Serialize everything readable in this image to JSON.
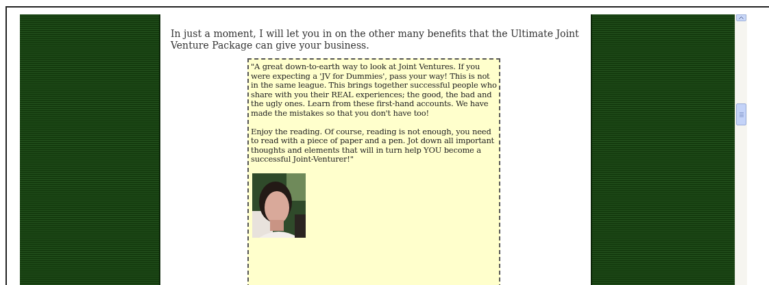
{
  "intro": "In just a moment, I will let you in on the other many benefits that the Ultimate Joint Venture Package can give your business.",
  "testimonial": {
    "paragraphs": [
      "\"A great down-to-earth way to look at Joint Ventures. If you were expecting a 'JV for Dummies', pass your way! This is not in the same league. This brings together successful people who share with you their REAL experiences; the good, the bad and the ugly ones. Learn from these first-hand accounts. We have made the mistakes so that you don't have too!",
      "Enjoy the reading. Of course, reading is not enough, you need to read with a piece of paper and a pen. Jot down all important thoughts and elements that will in turn help YOU become a successful Joint-Venturer!\""
    ]
  }
}
